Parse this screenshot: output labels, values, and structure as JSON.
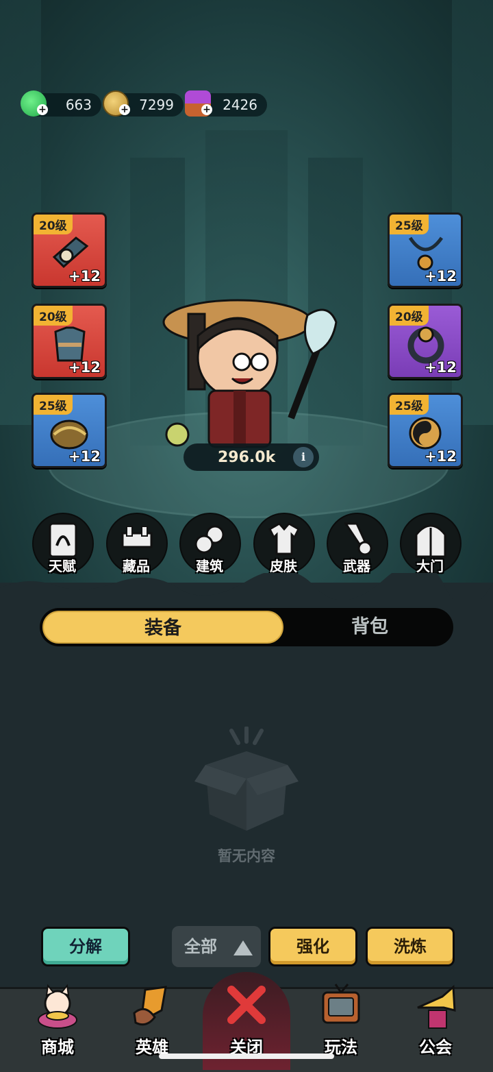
{
  "currencies": [
    {
      "icon": "green-jade-icon",
      "value": "663"
    },
    {
      "icon": "copper-coin-icon",
      "value": "7299"
    },
    {
      "icon": "purple-chest-icon",
      "value": "2426"
    }
  ],
  "left_slots": [
    {
      "level": "20级",
      "bonus": "+12",
      "color": "red",
      "icon": "hat-icon"
    },
    {
      "level": "20级",
      "bonus": "+12",
      "color": "red",
      "icon": "robe-icon"
    },
    {
      "level": "25级",
      "bonus": "+12",
      "color": "blue",
      "icon": "boots-icon"
    }
  ],
  "right_slots": [
    {
      "level": "25级",
      "bonus": "+12",
      "color": "blue",
      "icon": "necklace-icon"
    },
    {
      "level": "20级",
      "bonus": "+12",
      "color": "purple",
      "icon": "ring-icon"
    },
    {
      "level": "25级",
      "bonus": "+12",
      "color": "blue",
      "icon": "taiji-amulet-icon"
    }
  ],
  "power": {
    "value": "296.0k",
    "info_icon": "i"
  },
  "features": [
    {
      "label": "天赋",
      "icon": "talent-icon"
    },
    {
      "label": "藏品",
      "icon": "collection-icon"
    },
    {
      "label": "建筑",
      "icon": "building-icon"
    },
    {
      "label": "皮肤",
      "icon": "skin-icon"
    },
    {
      "label": "武器",
      "icon": "weapon-icon"
    },
    {
      "label": "大门",
      "icon": "gate-icon"
    }
  ],
  "tabs": {
    "active": "装备",
    "inactive": "背包"
  },
  "empty": {
    "text": "暂无内容"
  },
  "actions": {
    "decompose": "分解",
    "filter": "全部",
    "enhance": "强化",
    "refine": "洗炼"
  },
  "nav": [
    {
      "label": "商城",
      "icon": "lucky-cat-icon"
    },
    {
      "label": "英雄",
      "icon": "hero-weapon-icon"
    },
    {
      "label": "关闭",
      "icon": "close-icon"
    },
    {
      "label": "玩法",
      "icon": "tv-icon"
    },
    {
      "label": "公会",
      "icon": "trumpet-icon"
    }
  ]
}
